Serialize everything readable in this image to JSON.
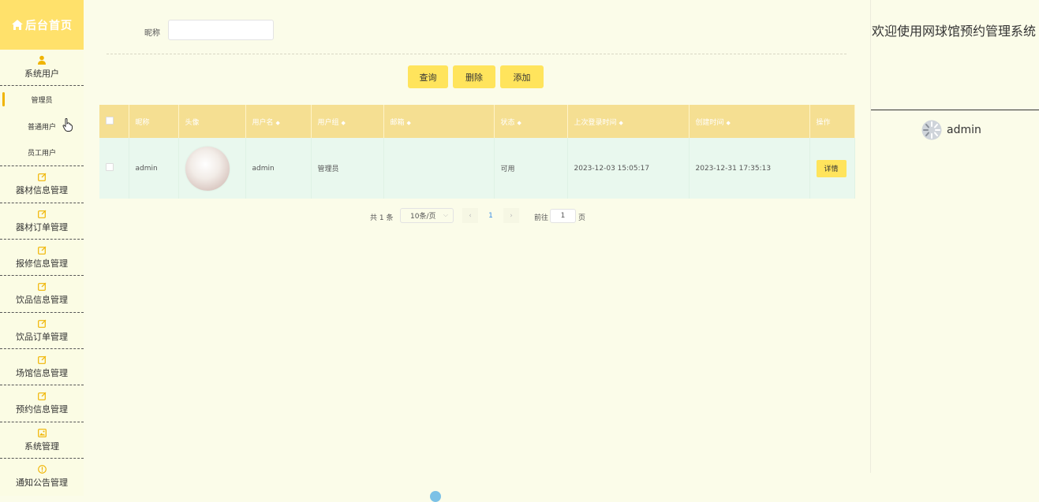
{
  "sidebar": {
    "logo_title": "后台首页",
    "groups": [
      {
        "label": "系统用户",
        "icon": "user-icon"
      },
      {
        "label": "器材信息管理",
        "icon": "edit-icon"
      },
      {
        "label": "器材订单管理",
        "icon": "edit-icon"
      },
      {
        "label": "报修信息管理",
        "icon": "edit-icon"
      },
      {
        "label": "饮品信息管理",
        "icon": "edit-icon"
      },
      {
        "label": "饮品订单管理",
        "icon": "edit-icon"
      },
      {
        "label": "场馆信息管理",
        "icon": "edit-icon"
      },
      {
        "label": "预约信息管理",
        "icon": "edit-icon"
      },
      {
        "label": "系统管理",
        "icon": "picture-icon"
      },
      {
        "label": "通知公告管理",
        "icon": "info-icon"
      }
    ],
    "sub_items": [
      "管理员",
      "普通用户",
      "员工用户"
    ]
  },
  "search": {
    "label": "昵称",
    "value": "",
    "placeholder": ""
  },
  "buttons": {
    "query": "查询",
    "delete": "删除",
    "add": "添加"
  },
  "table": {
    "headers": [
      "昵称",
      "头像",
      "用户名",
      "用户组",
      "邮箱",
      "状态",
      "上次登录时间",
      "创建时间",
      "操作"
    ],
    "sortable": [
      false,
      false,
      true,
      true,
      true,
      true,
      true,
      true,
      false
    ],
    "rows": [
      {
        "nickname": "admin",
        "username": "admin",
        "group": "管理员",
        "email": "",
        "status": "可用",
        "last_login": "2023-12-03 15:05:17",
        "created": "2023-12-31 17:35:13",
        "action": "详情"
      }
    ]
  },
  "pagination": {
    "total": "共 1 条",
    "page_size": "10条/页",
    "current_page": "1",
    "goto_label": "前往",
    "goto_value": "1",
    "page_unit": "页"
  },
  "header_right": {
    "welcome": "欢迎使用网球馆预约管理系统",
    "username": "admin"
  },
  "colors": {
    "accent": "#ffe45c",
    "logo_bg": "#ffe16b",
    "table_header": "#f5df92",
    "table_row": "#e9f8ee",
    "page_bg": "#fbfce9"
  }
}
